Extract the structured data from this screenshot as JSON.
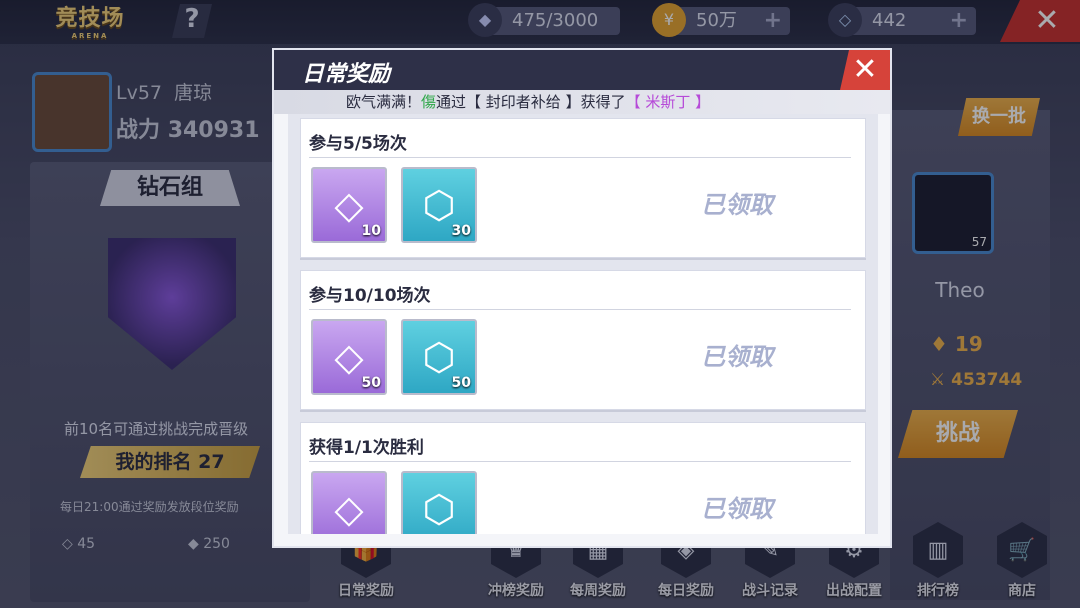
{
  "header": {
    "logo_text": "竞技场",
    "logo_sub": "ARENA",
    "help_label": "?",
    "resources": [
      {
        "icon": "crystal-icon",
        "value": "475/3000"
      },
      {
        "icon": "gold-coin-icon",
        "value": "50万"
      },
      {
        "icon": "diamond-icon",
        "value": "442"
      }
    ],
    "plus_label": "+",
    "close_label": "✕"
  },
  "player": {
    "level": "Lv57",
    "name": "唐琼",
    "power_label": "战力",
    "power_value": "340931",
    "tier": "钻石组",
    "promo_text": "前10名可通过挑战完成晋级",
    "my_rank_label": "我的排名",
    "my_rank_value": "27",
    "daily_reward_text": "每日21:00通过奖励发放段位奖励",
    "reward_1": "45",
    "reward_2": "250"
  },
  "opponent": {
    "refresh_label": "换一批",
    "name": "Theo",
    "avatar_level": "57",
    "rank": "19",
    "power": "453744",
    "challenge_label": "挑战"
  },
  "bottom_nav": [
    {
      "label": "日常奖励",
      "icon": "gift-icon"
    },
    {
      "label": "冲榜奖励",
      "icon": "trophy-icon"
    },
    {
      "label": "每周奖励",
      "icon": "calendar-icon"
    },
    {
      "label": "每日奖励",
      "icon": "badge-icon"
    },
    {
      "label": "战斗记录",
      "icon": "log-icon"
    },
    {
      "label": "出战配置",
      "icon": "config-icon"
    },
    {
      "label": "排行榜",
      "icon": "ranking-icon"
    },
    {
      "label": "商店",
      "icon": "shop-icon"
    }
  ],
  "modal": {
    "title": "日常奖励",
    "close_label": "✕",
    "marquee": {
      "prefix": "欧气满满！",
      "player": "傷",
      "middle": "通过【 封印者补给 】获得了",
      "item": "【 米斯丁 】"
    },
    "tasks": [
      {
        "label": "参与5/5场次",
        "status": "已领取",
        "rewards": [
          {
            "type": "gem",
            "qty": "10"
          },
          {
            "type": "token",
            "qty": "30"
          }
        ]
      },
      {
        "label": "参与10/10场次",
        "status": "已领取",
        "rewards": [
          {
            "type": "gem",
            "qty": "50"
          },
          {
            "type": "token",
            "qty": "50"
          }
        ]
      },
      {
        "label": "获得1/1次胜利",
        "status": "已领取",
        "rewards": [
          {
            "type": "gem",
            "qty": ""
          },
          {
            "type": "token",
            "qty": ""
          }
        ]
      }
    ]
  },
  "colors": {
    "accent_orange": "#f0b24a",
    "close_red": "#d6433a",
    "highlight_green": "#2fa84a",
    "highlight_purple": "#b64ad8"
  }
}
